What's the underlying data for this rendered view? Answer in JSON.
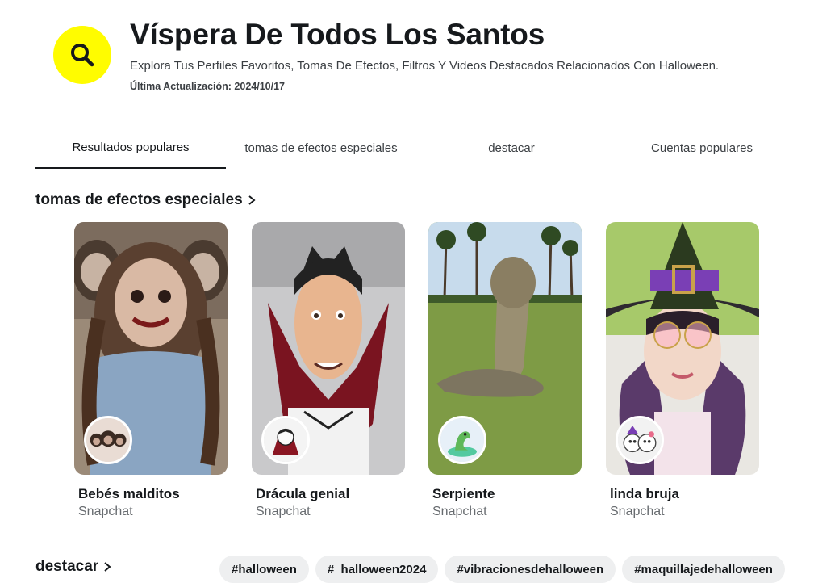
{
  "header": {
    "icon": "search-icon",
    "accent_color": "#fffc00",
    "title": "Víspera De Todos Los Santos",
    "subtitle": "Explora Tus Perfiles Favoritos, Tomas De Efectos, Filtros Y Videos Destacados Relacionados Con Halloween.",
    "updated": "Última Actualización: 2024/10/17"
  },
  "tabs": [
    {
      "label": "Resultados populares",
      "active": true
    },
    {
      "label": "tomas de efectos especiales",
      "active": false
    },
    {
      "label": "destacar",
      "active": false
    },
    {
      "label": "Cuentas populares",
      "active": false
    }
  ],
  "effects_section": {
    "title": "tomas de efectos especiales",
    "chevron": "chevron-right-icon",
    "cards": [
      {
        "title": "Bebés malditos",
        "creator": "Snapchat"
      },
      {
        "title": "Drácula genial",
        "creator": "Snapchat"
      },
      {
        "title": "Serpiente",
        "creator": "Snapchat"
      },
      {
        "title": "linda bruja",
        "creator": "Snapchat"
      }
    ]
  },
  "highlight_section": {
    "title": "destacar",
    "chevron": "chevron-right-icon",
    "hashtags": [
      "#halloween",
      "#  halloween2024",
      "#vibracionesdehalloween",
      "#maquillajedehalloween"
    ]
  }
}
